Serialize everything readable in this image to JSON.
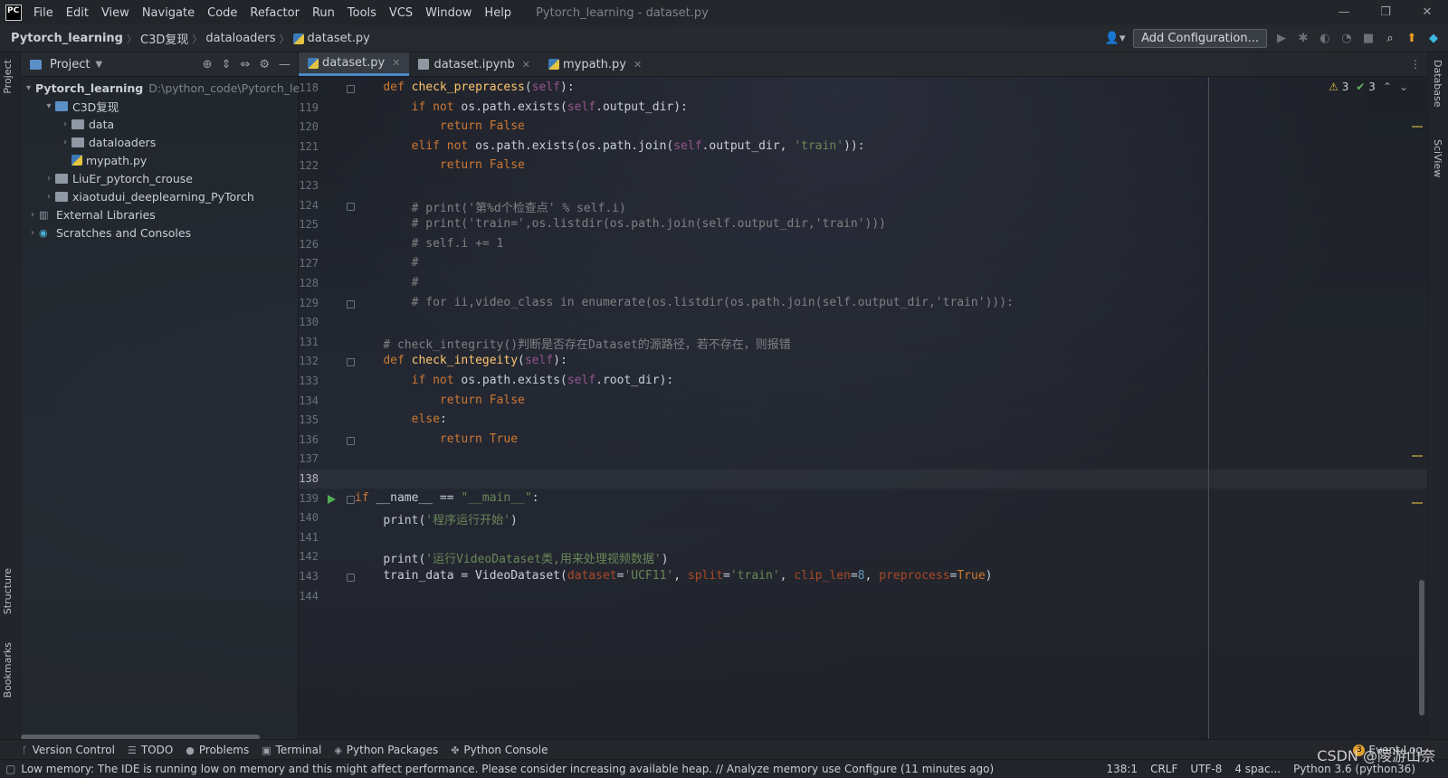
{
  "app": {
    "logo_text": "PC",
    "menu": [
      "File",
      "Edit",
      "View",
      "Navigate",
      "Code",
      "Refactor",
      "Run",
      "Tools",
      "VCS",
      "Window",
      "Help"
    ],
    "window_title": "Pytorch_learning - dataset.py",
    "win_controls": [
      "—",
      "❐",
      "✕"
    ]
  },
  "breadcrumb": [
    "Pytorch_learning",
    "C3D复现",
    "dataloaders",
    "dataset.py"
  ],
  "toolbar": {
    "add_configuration": "Add Configuration..."
  },
  "left_tabs": [
    "Project",
    "Structure",
    "Bookmarks"
  ],
  "right_tabs": [
    "Database",
    "SciView"
  ],
  "project_panel": {
    "title": "Project",
    "tree": [
      {
        "label": "Pytorch_learning",
        "hint": "D:\\python_code\\Pytorch_le",
        "depth": 0,
        "arrow": "▾",
        "kind": "folder",
        "bold": true
      },
      {
        "label": "C3D复现",
        "depth": 1,
        "arrow": "▾",
        "kind": "folder-blue"
      },
      {
        "label": "data",
        "depth": 2,
        "arrow": "›",
        "kind": "folder"
      },
      {
        "label": "dataloaders",
        "depth": 2,
        "arrow": "›",
        "kind": "folder"
      },
      {
        "label": "mypath.py",
        "depth": 2,
        "arrow": "",
        "kind": "py"
      },
      {
        "label": "LiuEr_pytorch_crouse",
        "depth": 1,
        "arrow": "›",
        "kind": "folder"
      },
      {
        "label": "xiaotudui_deeplearning_PyTorch",
        "depth": 1,
        "arrow": "›",
        "kind": "folder"
      },
      {
        "label": "External Libraries",
        "depth": 0,
        "arrow": "›",
        "kind": "libs"
      },
      {
        "label": "Scratches and Consoles",
        "depth": 0,
        "arrow": "›",
        "kind": "scratch"
      }
    ]
  },
  "tabs": [
    {
      "label": "dataset.py",
      "active": true,
      "icon": "py"
    },
    {
      "label": "dataset.ipynb",
      "active": false,
      "icon": "nb"
    },
    {
      "label": "mypath.py",
      "active": false,
      "icon": "py"
    }
  ],
  "inspections": {
    "warnings": "3",
    "weak": "3"
  },
  "editor": {
    "first_line": 118,
    "current_line": 138,
    "run_line": 139,
    "lines": [
      [
        [
          "    ",
          ""
        ],
        [
          "def ",
          "kw"
        ],
        [
          "check_prepracess",
          "fn"
        ],
        [
          "(",
          ""
        ],
        [
          "self",
          "self"
        ],
        [
          "):",
          ""
        ]
      ],
      [
        [
          "        ",
          ""
        ],
        [
          "if not ",
          "kw"
        ],
        [
          "os.path.exists(",
          ""
        ],
        [
          "self",
          "self"
        ],
        [
          ".output_dir):",
          ""
        ]
      ],
      [
        [
          "            ",
          ""
        ],
        [
          "return False",
          "kw"
        ]
      ],
      [
        [
          "        ",
          ""
        ],
        [
          "elif not ",
          "kw"
        ],
        [
          "os.path.exists(os.path.join(",
          ""
        ],
        [
          "self",
          "self"
        ],
        [
          ".output_dir, ",
          ""
        ],
        [
          "'train'",
          "str"
        ],
        [
          ")):",
          ""
        ]
      ],
      [
        [
          "            ",
          ""
        ],
        [
          "return False",
          "kw"
        ]
      ],
      [
        [
          "",
          ""
        ]
      ],
      [
        [
          "        ",
          ""
        ],
        [
          "# print('第%d个检查点' % self.i)",
          "cm"
        ]
      ],
      [
        [
          "        ",
          ""
        ],
        [
          "# print('train=',os.listdir(os.path.join(self.output_dir,'train')))",
          "cm"
        ]
      ],
      [
        [
          "        ",
          ""
        ],
        [
          "# self.i += 1",
          "cm"
        ]
      ],
      [
        [
          "        ",
          ""
        ],
        [
          "#",
          "cm"
        ]
      ],
      [
        [
          "        ",
          ""
        ],
        [
          "#",
          "cm"
        ]
      ],
      [
        [
          "        ",
          ""
        ],
        [
          "# for ii,video_class in enumerate(os.listdir(os.path.join(self.output_dir,'train'))):",
          "cm"
        ]
      ],
      [
        [
          "",
          ""
        ]
      ],
      [
        [
          "    ",
          ""
        ],
        [
          "# check_integrity()判断是否存在Dataset的源路径，若不存在，则报错",
          "cm"
        ]
      ],
      [
        [
          "    ",
          ""
        ],
        [
          "def ",
          "kw"
        ],
        [
          "check_integeity",
          "fn"
        ],
        [
          "(",
          ""
        ],
        [
          "self",
          "self"
        ],
        [
          "):",
          ""
        ]
      ],
      [
        [
          "        ",
          ""
        ],
        [
          "if not ",
          "kw"
        ],
        [
          "os.path.exists(",
          ""
        ],
        [
          "self",
          "self"
        ],
        [
          ".root_dir):",
          ""
        ]
      ],
      [
        [
          "            ",
          ""
        ],
        [
          "return False",
          "kw"
        ]
      ],
      [
        [
          "        ",
          ""
        ],
        [
          "else",
          "kw"
        ],
        [
          ":",
          ""
        ]
      ],
      [
        [
          "            ",
          ""
        ],
        [
          "return True",
          "kw"
        ]
      ],
      [
        [
          "",
          ""
        ]
      ],
      [
        [
          "",
          ""
        ]
      ],
      [
        [
          "if ",
          "kw"
        ],
        [
          "__name__ == ",
          ""
        ],
        [
          "\"__main__\"",
          "str"
        ],
        [
          ":",
          ""
        ]
      ],
      [
        [
          "    ",
          ""
        ],
        [
          "print(",
          ""
        ],
        [
          "'程序运行开始'",
          "str"
        ],
        [
          ")",
          ""
        ]
      ],
      [
        [
          "",
          ""
        ]
      ],
      [
        [
          "    ",
          ""
        ],
        [
          "print(",
          ""
        ],
        [
          "'运行VideoDataset类,用来处理视频数据'",
          "str"
        ],
        [
          ")",
          ""
        ]
      ],
      [
        [
          "    ",
          ""
        ],
        [
          "train_data = VideoDataset(",
          ""
        ],
        [
          "dataset",
          "param"
        ],
        [
          "=",
          ""
        ],
        [
          "'UCF11'",
          "str"
        ],
        [
          ", ",
          ""
        ],
        [
          "split",
          "param"
        ],
        [
          "=",
          ""
        ],
        [
          "'train'",
          "str"
        ],
        [
          ", ",
          ""
        ],
        [
          "clip_len",
          "param"
        ],
        [
          "=",
          ""
        ],
        [
          "8",
          "num"
        ],
        [
          ", ",
          ""
        ],
        [
          "preprocess",
          "param"
        ],
        [
          "=",
          ""
        ],
        [
          "True",
          "kw"
        ],
        [
          ")",
          ""
        ]
      ],
      [
        [
          "",
          ""
        ]
      ]
    ]
  },
  "bottom_tools": [
    "Version Control",
    "TODO",
    "Problems",
    "Terminal",
    "Python Packages",
    "Python Console"
  ],
  "event_log": {
    "label": "Event Log",
    "count": "3"
  },
  "status": {
    "message": "Low memory: The IDE is running low on memory and this might affect performance. Please consider increasing available heap. // Analyze memory use   Configure (11 minutes ago)",
    "position": "138:1",
    "line_sep": "CRLF",
    "encoding": "UTF-8",
    "indent": "4 spac...",
    "interpreter": "Python 3.6 (python36)"
  },
  "watermark": "CSDN @陵游山奈"
}
